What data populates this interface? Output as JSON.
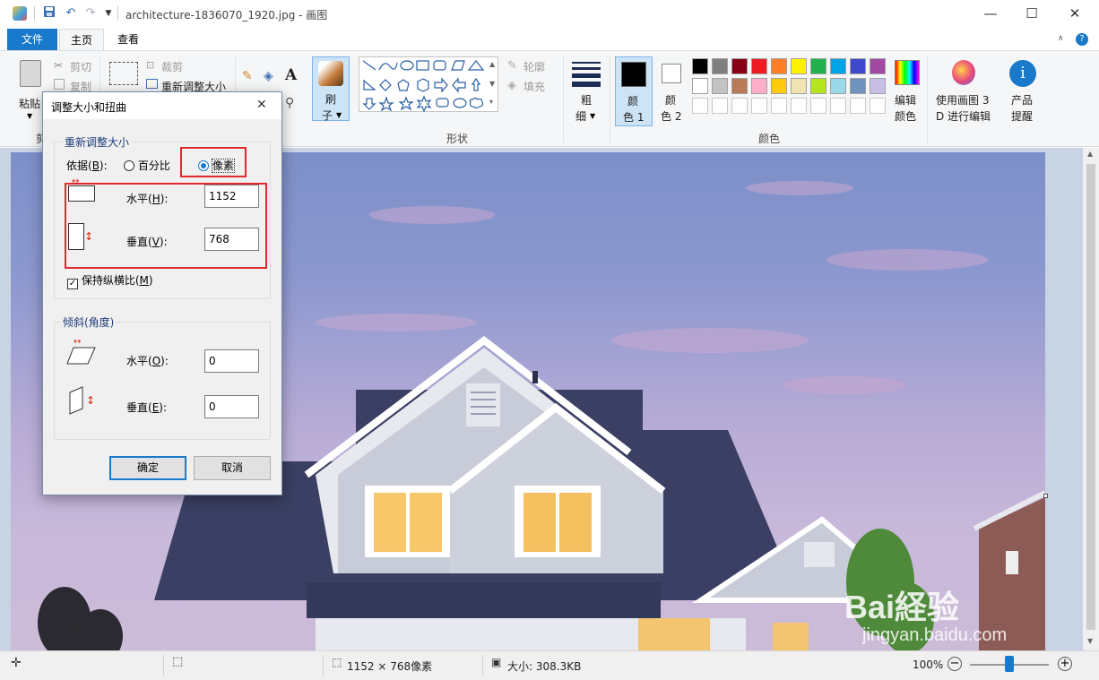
{
  "window": {
    "title": "architecture-1836070_1920.jpg - 画图",
    "minimize": "—",
    "maximize": "☐",
    "close": "✕"
  },
  "quick_access": {
    "save_icon": "save-icon",
    "undo_icon": "undo-icon",
    "redo_icon": "redo-icon"
  },
  "tabs": {
    "file": "文件",
    "home": "主页",
    "view": "查看"
  },
  "ribbon": {
    "clipboard": {
      "paste": "粘贴",
      "cut": "剪切",
      "copy": "复制",
      "label": "剪"
    },
    "image": {
      "crop": "裁剪",
      "resize": "重新调整大小"
    },
    "brushes": {
      "label_line1": "刷",
      "label_line2": "子"
    },
    "shapes": {
      "outline": "轮廓",
      "fill": "填充",
      "label": "形状"
    },
    "size": {
      "line1": "粗",
      "line2": "细"
    },
    "color1": {
      "line1": "颜",
      "line2": "色 1"
    },
    "color2": {
      "line1": "颜",
      "line2": "色 2"
    },
    "colors_label": "颜色",
    "edit_colors": {
      "line1": "编辑",
      "line2": "颜色"
    },
    "paint3d": {
      "line1": "使用画图 3",
      "line2": "D 进行编辑"
    },
    "tips": {
      "line1": "产品",
      "line2": "提醒"
    },
    "palette_row1": [
      "#000000",
      "#7f7f7f",
      "#880015",
      "#ed1c24",
      "#ff7f27",
      "#fff200",
      "#22b14c",
      "#00a2e8",
      "#3f48cc",
      "#a349a4"
    ],
    "palette_row2": [
      "#ffffff",
      "#c3c3c3",
      "#b97a57",
      "#ffaec9",
      "#ffc90e",
      "#efe4b0",
      "#b5e61d",
      "#99d9ea",
      "#7092be",
      "#c8bfe7"
    ]
  },
  "dialog": {
    "title": "调整大小和扭曲",
    "close": "✕",
    "resize_group": "重新调整大小",
    "by_label": "依据(",
    "by_key": "B",
    "by_end": "):",
    "percent": "百分比",
    "pixels": "像素",
    "horizontal_label": "水平(",
    "horizontal_key": "H",
    "vertical_label": "垂直(",
    "vertical_key": "V",
    "label_end": "):",
    "horizontal_value": "1152",
    "vertical_value": "768",
    "keep_ratio_pre": "保持纵横比(",
    "keep_ratio_key": "M",
    "keep_ratio_end": ")",
    "skew_group": "倾斜(角度)",
    "skew_h_label": "水平(",
    "skew_h_key": "O",
    "skew_v_label": "垂直(",
    "skew_v_key": "E",
    "skew_h_value": "0",
    "skew_v_value": "0",
    "ok": "确定",
    "cancel": "取消"
  },
  "status": {
    "dimensions": "1152 × 768像素",
    "size": "大小: 308.3KB",
    "zoom": "100%"
  },
  "watermark": {
    "text": "Bai経验",
    "url": "jingyan.baidu.com"
  }
}
